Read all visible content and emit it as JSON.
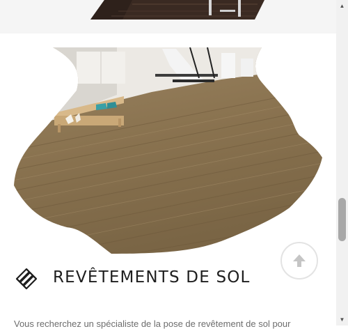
{
  "services": {
    "title": "REVÊTEMENTS DE SOL",
    "description": "Vous recherchez un spécialiste de la pose de revêtement de sol pour"
  },
  "icons": {
    "scroll_top": "arrow-up-icon",
    "service": "parquet-pattern-icon",
    "scroll_up": "scrollbar-up-arrow-icon",
    "scroll_down": "scrollbar-down-arrow-icon"
  },
  "colors": {
    "top_band": "#f5f5f5",
    "title": "#1e1e1e",
    "body_text": "#6d6d6d",
    "wood_floor": "#8a7350",
    "scroll_arrow": "#c5c5c5"
  }
}
